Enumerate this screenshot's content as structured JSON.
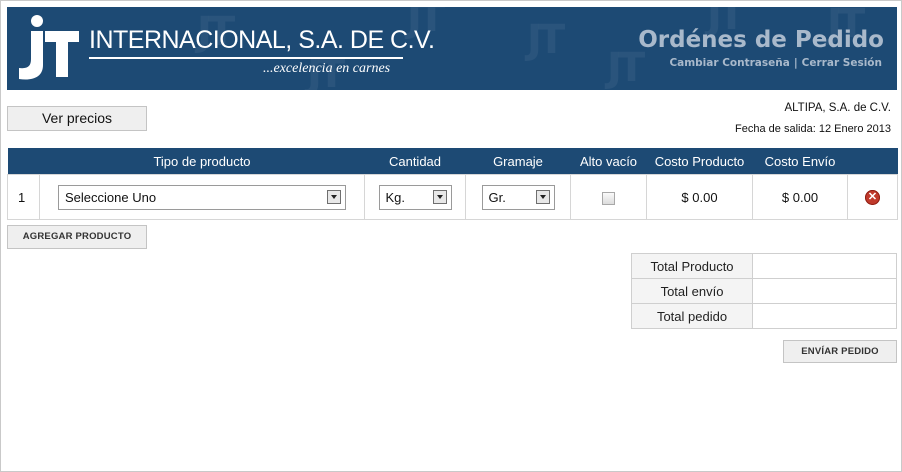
{
  "header": {
    "company_name": "INTERNACIONAL, S.A. DE C.V.",
    "slogan": "...excelencia en carnes",
    "logo_letters": "JT",
    "page_title": "Ordénes de Pedido",
    "change_password": "Cambiar Contraseña",
    "separator": "|",
    "logout": "Cerrar Sesión"
  },
  "toolbar": {
    "ver_precios": "Ver precios",
    "client_name": "ALTIPA, S.A. de C.V.",
    "fecha_salida": "Fecha de salida: 12 Enero 2013"
  },
  "order_table": {
    "columns": {
      "tipo": "Tipo de producto",
      "cantidad": "Cantidad",
      "gramaje": "Gramaje",
      "alto_vacio": "Alto vacío",
      "costo_producto": "Costo Producto",
      "costo_envio": "Costo Envío"
    },
    "rows": [
      {
        "num": "1",
        "producto": "Seleccione Uno",
        "cantidad_unit": "Kg.",
        "gramaje_unit": "Gr.",
        "alto_vacio": false,
        "costo_producto": "$ 0.00",
        "costo_envio": "$ 0.00"
      }
    ]
  },
  "actions": {
    "agregar_producto": "AGREGAR PRODUCTO",
    "enviar_pedido": "ENVÍAR PEDIDO"
  },
  "totals": {
    "total_producto": "Total Producto",
    "total_envio": "Total envío",
    "total_pedido": "Total pedido"
  },
  "colors": {
    "header_blue": "#1d4a74",
    "title_grey": "#a9b9cb",
    "delete_red": "#c0392b"
  },
  "icons": {
    "dropdown": "chevron-down-icon",
    "delete": "delete-row-icon"
  }
}
